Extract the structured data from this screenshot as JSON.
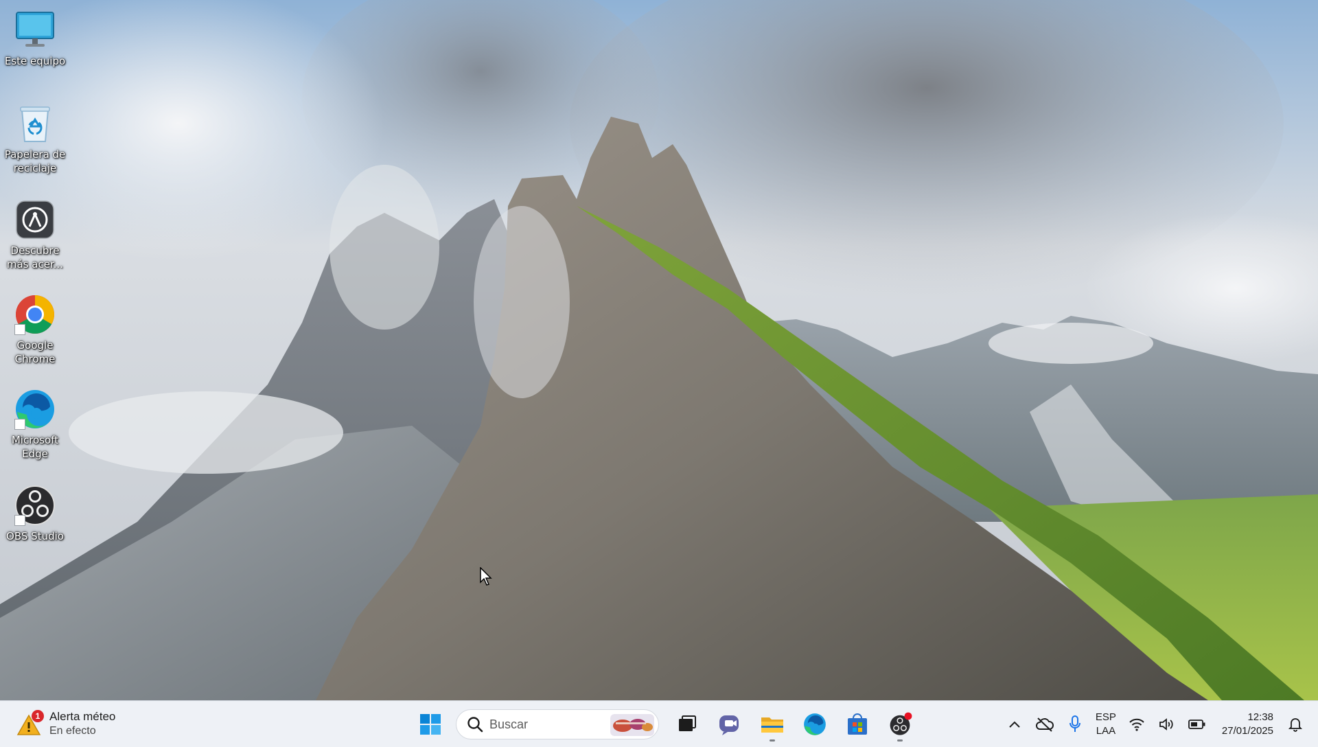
{
  "desktop": {
    "icons": [
      {
        "label": "Este equipo",
        "icon": "monitor-icon"
      },
      {
        "label": "Papelera de reciclaje",
        "icon": "recycle-bin-icon"
      },
      {
        "label": "Descubre más acer...",
        "icon": "acer-care-icon"
      },
      {
        "label": "Google Chrome",
        "icon": "chrome-icon"
      },
      {
        "label": "Microsoft Edge",
        "icon": "edge-icon"
      },
      {
        "label": "OBS Studio",
        "icon": "obs-icon"
      }
    ]
  },
  "taskbar": {
    "weather": {
      "title": "Alerta méteo",
      "subtitle": "En efecto",
      "badge": "1",
      "icon": "weather-alert-icon"
    },
    "search": {
      "placeholder": "Buscar"
    },
    "apps": [
      {
        "name": "start",
        "icon": "windows-logo-icon"
      },
      {
        "name": "task-view",
        "icon": "task-view-icon"
      },
      {
        "name": "teams",
        "icon": "teams-icon"
      },
      {
        "name": "file-explorer",
        "icon": "folder-icon",
        "running": true
      },
      {
        "name": "edge",
        "icon": "edge-icon"
      },
      {
        "name": "store",
        "icon": "store-icon"
      },
      {
        "name": "obs",
        "icon": "obs-icon",
        "running": true
      }
    ],
    "tray": {
      "language_line1": "ESP",
      "language_line2": "LAA",
      "time": "12:38",
      "date": "27/01/2025"
    }
  },
  "colors": {
    "taskbar_bg": "#eef1f6",
    "badge_red": "#d9262b",
    "accent_blue": "#0078d4"
  }
}
